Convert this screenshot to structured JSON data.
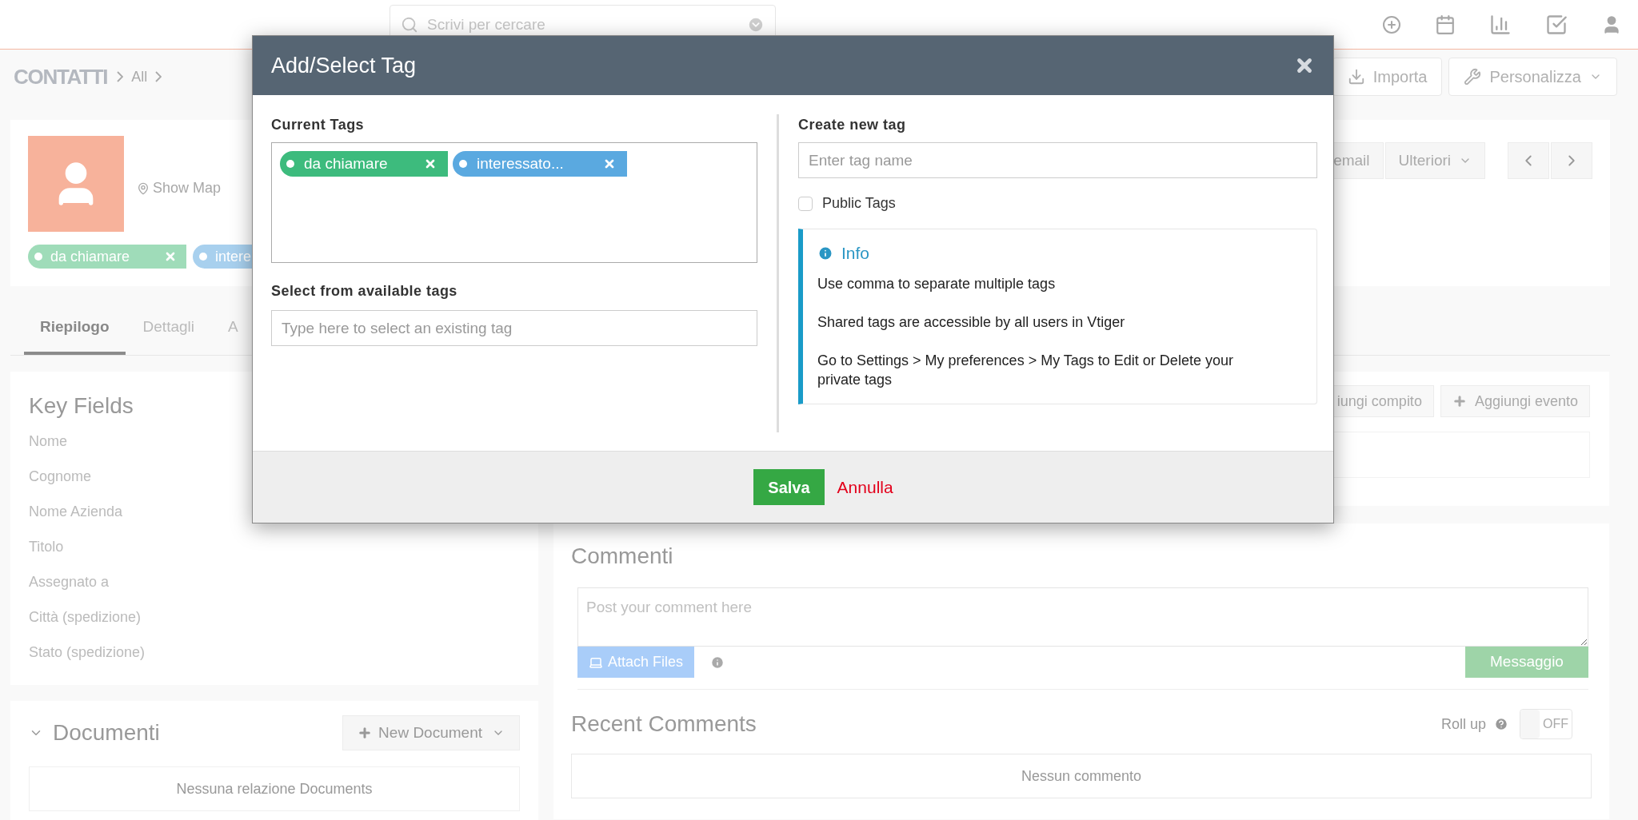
{
  "top_bar": {
    "search": {
      "placeholder": "Scrivi per cercare"
    }
  },
  "breadcrumb": {
    "module": "CONTATTI",
    "items": [
      "All"
    ]
  },
  "header_buttons": [
    {
      "label": "Importa",
      "kind": "import"
    },
    {
      "label": "Personalizza",
      "kind": "customize"
    }
  ],
  "record": {
    "show_map": "Show Map",
    "tags": [
      {
        "label": "da chiamare",
        "color": "#9fdcb9"
      },
      {
        "label": "intere",
        "color": "#a8d0ee"
      }
    ],
    "actions": [
      {
        "label": "email",
        "kind": "plain"
      },
      {
        "label": "Ulteriori",
        "kind": "dropdown"
      }
    ]
  },
  "tabs": [
    {
      "label": "Riepilogo",
      "selected": true
    },
    {
      "label": "Dettagli",
      "selected": false
    },
    {
      "label": "A",
      "selected": false
    }
  ],
  "key_fields": {
    "title": "Key Fields",
    "fields": [
      "Nome",
      "Cognome",
      "Nome Azienda",
      "Titolo",
      "Assegnato a",
      "Città (spedizione)",
      "Stato (spedizione)"
    ]
  },
  "documents": {
    "title": "Documenti",
    "expanded": true,
    "new_button": "New Document",
    "empty": "Nessuna relazione Documents"
  },
  "activity_buttons": [
    {
      "label": "iungi compito"
    },
    {
      "label": "Aggiungi evento"
    }
  ],
  "comments": {
    "title": "Commenti",
    "placeholder": "Post your comment here",
    "attach": "Attach Files",
    "send": "Messaggio",
    "recent_title": "Recent Comments",
    "rollup": {
      "label": "Roll up",
      "on": false,
      "state_text": "OFF"
    },
    "empty": "Nessun commento"
  },
  "modal": {
    "title": "Add/Select Tag",
    "current_label": "Current Tags",
    "current_tags": [
      {
        "label": "da chiamare",
        "color": "#3dbb7d"
      },
      {
        "label": "interessato...",
        "color": "#5aa9e0"
      }
    ],
    "select_label": "Select from available tags",
    "select_placeholder": "Type here to select an existing tag",
    "create_label": "Create new tag",
    "create_placeholder": "Enter tag name",
    "public_tags": {
      "label": "Public Tags",
      "checked": false
    },
    "info": {
      "title": "Info",
      "lines": [
        "Use comma to separate multiple tags",
        "Shared tags are accessible by all users in Vtiger",
        "Go to Settings > My preferences > My Tags to Edit or Delete your private tags"
      ]
    },
    "save": "Salva",
    "cancel": "Annulla"
  }
}
